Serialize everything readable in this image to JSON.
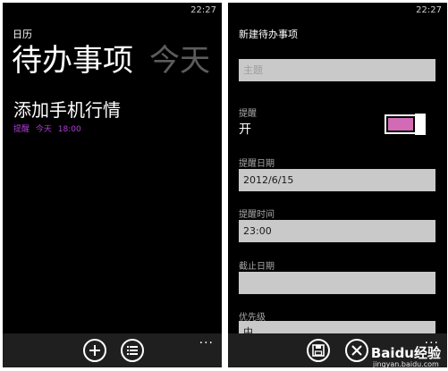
{
  "left_screen": {
    "status_time": "22:27",
    "app_title": "日历",
    "pivot_active": "待办事项",
    "pivot_next": "今天",
    "task": {
      "title": "添加手机行情",
      "reminder_label": "提醒",
      "reminder_day": "今天",
      "reminder_time": "18:00"
    },
    "appbar": {
      "buttons": [
        {
          "icon": "add-icon"
        },
        {
          "icon": "list-icon"
        }
      ],
      "more": "..."
    }
  },
  "right_screen": {
    "status_time": "22:27",
    "form_title": "新建待办事项",
    "subject_placeholder": "主题",
    "reminder": {
      "label": "提醒",
      "value": "开",
      "on": true,
      "accent_color": "#d26ab6"
    },
    "reminder_date": {
      "label": "提醒日期",
      "value": "2012/6/15"
    },
    "reminder_time": {
      "label": "提醒时间",
      "value": "23:00"
    },
    "due_date": {
      "label": "截止日期",
      "value": ""
    },
    "priority": {
      "label": "优先级",
      "value": "中"
    },
    "appbar": {
      "buttons": [
        {
          "icon": "save-icon"
        },
        {
          "icon": "cancel-icon"
        }
      ],
      "more": "..."
    }
  },
  "watermark": {
    "brand": "Baidu经验",
    "url": "jingyan.baidu.com"
  }
}
